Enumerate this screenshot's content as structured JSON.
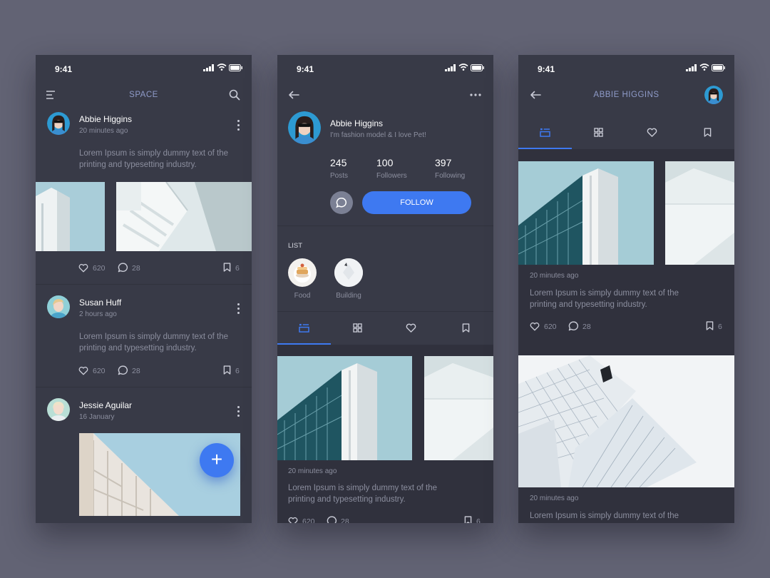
{
  "status_time": "9:41",
  "colors": {
    "accent": "#3e79f1",
    "panel": "#383a47",
    "background": "#626374"
  },
  "feed": {
    "title": "SPACE",
    "posts": [
      {
        "name": "Abbie Higgins",
        "time": "20 minutes ago",
        "text": "Lorem Ipsum is simply dummy text of the printing and typesetting industry.",
        "likes": "620",
        "comments": "28",
        "saves": "6"
      },
      {
        "name": "Susan Huff",
        "time": "2 hours ago",
        "text": "Lorem Ipsum is simply dummy text of the printing and typesetting industry.",
        "likes": "620",
        "comments": "28",
        "saves": "6"
      },
      {
        "name": "Jessie Aguilar",
        "time": "16 January"
      }
    ],
    "fab_label": "+"
  },
  "profile": {
    "name": "Abbie Higgins",
    "bio": "I'm fashion model & I love Pet!",
    "stats": [
      {
        "value": "245",
        "label": "Posts"
      },
      {
        "value": "100",
        "label": "Followers"
      },
      {
        "value": "397",
        "label": "Following"
      }
    ],
    "follow_label": "FOLLOW",
    "list_title": "LIST",
    "lists": [
      {
        "label": "Food"
      },
      {
        "label": "Building"
      }
    ],
    "post": {
      "time": "20 minutes ago",
      "text": "Lorem Ipsum is simply dummy text of the printing and typesetting industry.",
      "likes": "620",
      "comments": "28",
      "saves": "6"
    }
  },
  "detail": {
    "title": "ABBIE HIGGINS",
    "posts": [
      {
        "time": "20 minutes ago",
        "text": "Lorem Ipsum is simply dummy text of the printing and typesetting industry.",
        "likes": "620",
        "comments": "28",
        "saves": "6"
      },
      {
        "time": "20 minutes ago",
        "text": "Lorem Ipsum is simply dummy text of the"
      }
    ]
  }
}
